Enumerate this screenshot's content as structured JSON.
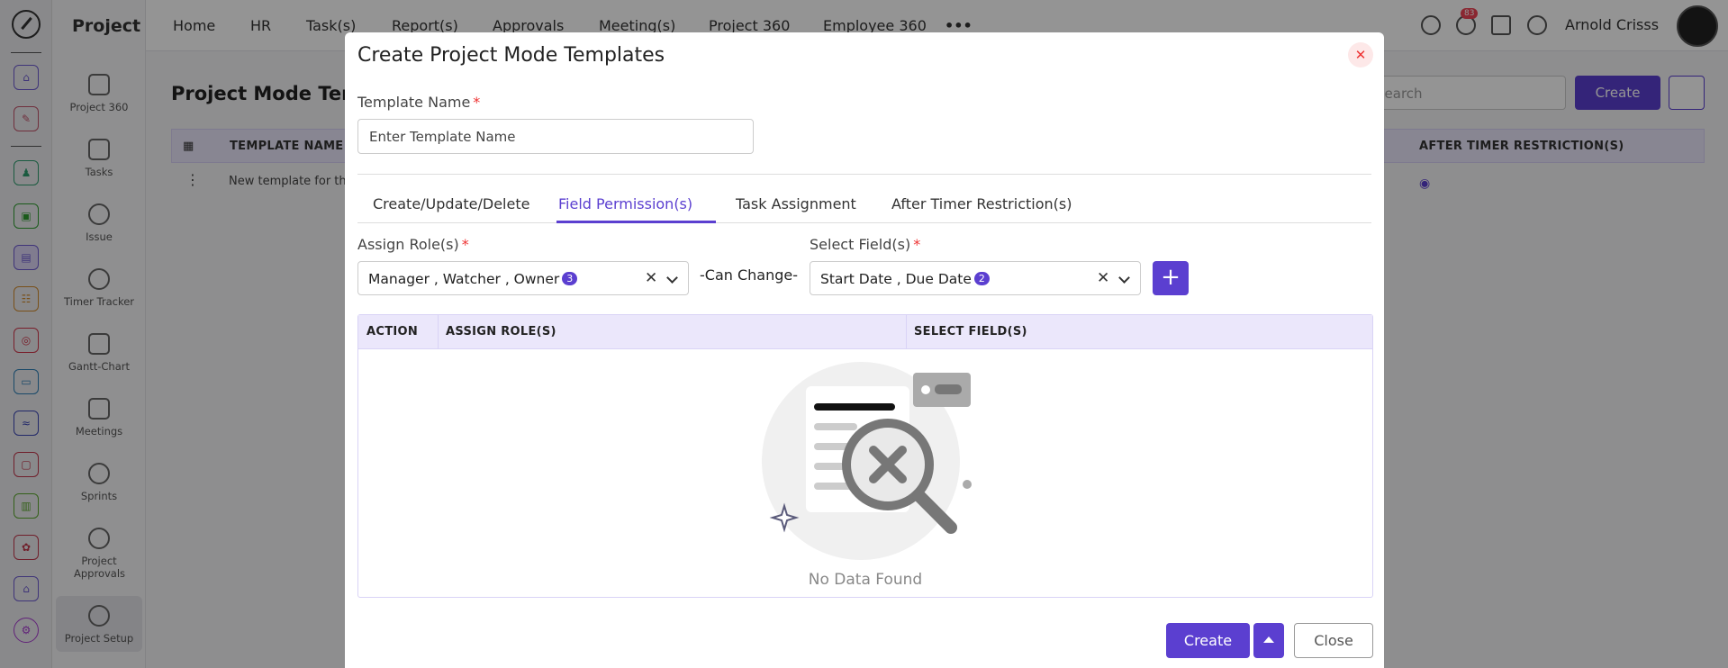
{
  "app": {
    "module_title": "Project"
  },
  "modules": [
    {
      "label": "Project 360"
    },
    {
      "label": "Tasks"
    },
    {
      "label": "Issue"
    },
    {
      "label": "Timer Tracker"
    },
    {
      "label": "Gantt-Chart"
    },
    {
      "label": "Meetings"
    },
    {
      "label": "Sprints"
    },
    {
      "label": "Project Approvals"
    },
    {
      "label": "Project Setup"
    }
  ],
  "topnav": {
    "items": [
      "Home",
      "HR",
      "Task(s)",
      "Report(s)",
      "Approvals",
      "Meeting(s)",
      "Project 360",
      "Employee 360"
    ],
    "notification_count": "83",
    "user_name": "Arnold Crisss"
  },
  "page": {
    "title": "Project Mode Tem",
    "search_placeholder": "Search",
    "create_label": "Create",
    "columns": {
      "template_name": "TEMPLATE NAME",
      "after_timer": "AFTER TIMER RESTRICTION(S)"
    },
    "row_text": "New template for th"
  },
  "modal": {
    "title": "Create Project Mode Templates",
    "template_name_label": "Template Name",
    "template_name_placeholder": "Enter Template Name",
    "tabs": [
      "Create/Update/Delete",
      "Field Permission(s)",
      "Task Assignment",
      "After Timer Restriction(s)"
    ],
    "active_tab": "Field Permission(s)",
    "assign_roles_label": "Assign Role(s)",
    "assign_roles_value": "Manager , Watcher , Owner",
    "assign_roles_count": "3",
    "can_change": "-Can Change-",
    "select_fields_label": "Select Field(s)",
    "select_fields_value": "Start Date , Due Date",
    "select_fields_count": "2",
    "table": {
      "headers": [
        "ACTION",
        "ASSIGN ROLE(S)",
        "SELECT FIELD(S)"
      ],
      "empty_text": "No Data Found"
    },
    "create_label": "Create",
    "close_label": "Close"
  },
  "colors": {
    "accent": "#5b3fd0",
    "header_bg": "#ebe7fb",
    "danger": "#e33333"
  }
}
